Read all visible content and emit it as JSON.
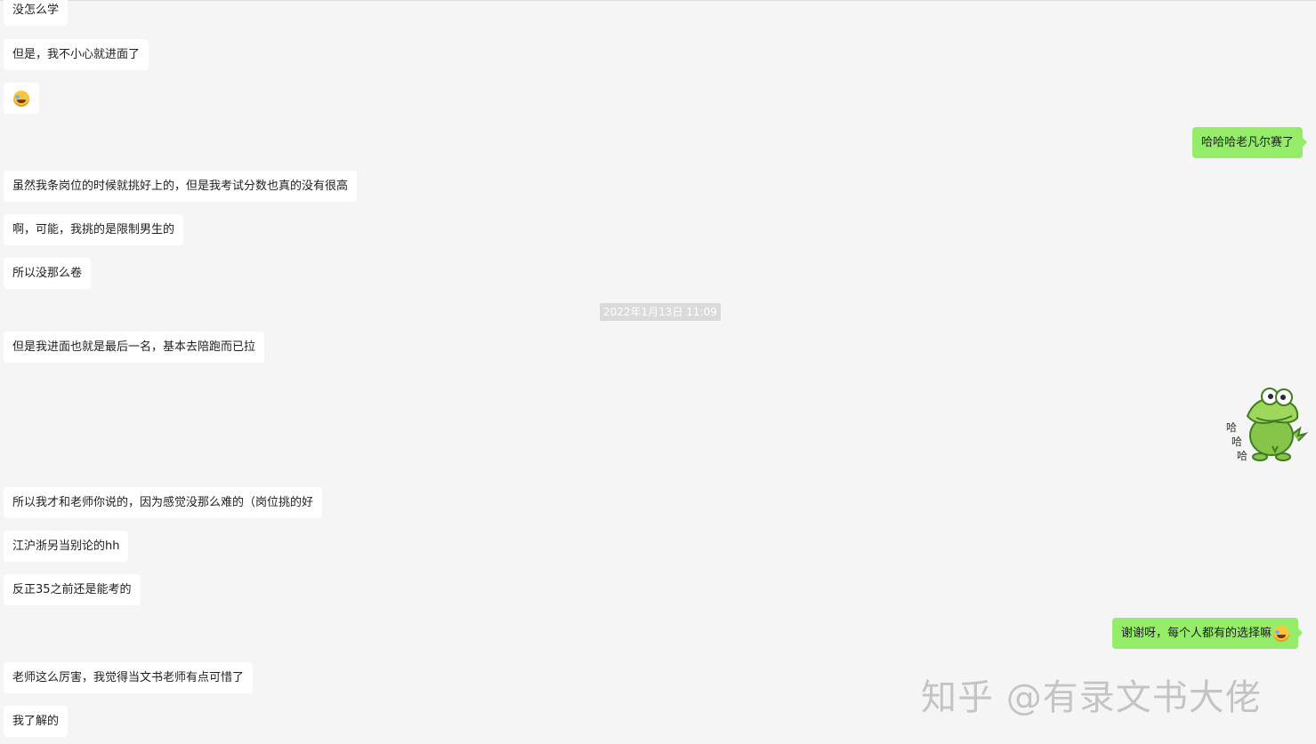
{
  "timestamp": "2022年1月13日 11:09",
  "messages": [
    {
      "text": "没怎么学"
    },
    {
      "text": "但是，我不小心就进面了"
    },
    {
      "text": "哈哈哈老凡尔赛了"
    },
    {
      "text": "虽然我条岗位的时候就挑好上的，但是我考试分数也真的没有很高"
    },
    {
      "text": "啊，可能，我挑的是限制男生的"
    },
    {
      "text": "所以没那么卷"
    },
    {
      "text": "但是我进面也就是最后一名，基本去陪跑而已拉"
    },
    {
      "text": "所以我才和老师你说的，因为感觉没那么难的（岗位挑的好"
    },
    {
      "text": "江沪浙另当别论的hh"
    },
    {
      "text": "反正35之前还是能考的"
    },
    {
      "text": "谢谢呀，每个人都有的选择嘛"
    },
    {
      "text": "老师这么厉害，我觉得当文书老师有点可惜了"
    },
    {
      "text": "我了解的"
    }
  ],
  "sticker_text": [
    "哈",
    "哈",
    "哈"
  ],
  "watermark": "知乎 @有录文书大佬",
  "colors": {
    "sent_bubble": "#95ec69",
    "received_bubble": "#ffffff",
    "background": "#f5f5f5"
  }
}
